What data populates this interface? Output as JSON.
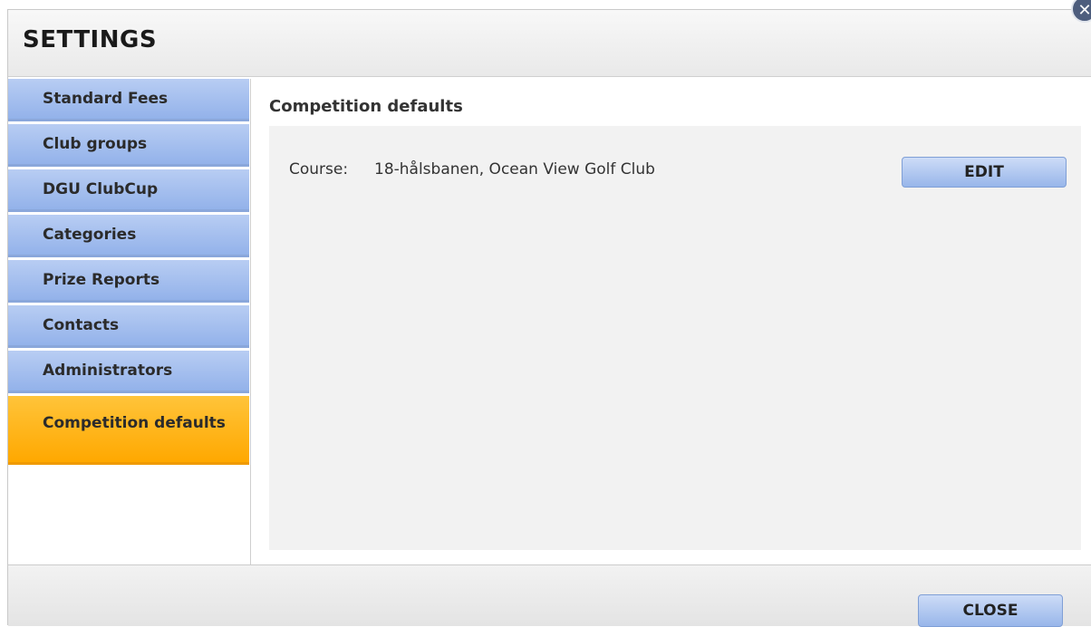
{
  "dialog": {
    "title": "SETTINGS",
    "close_icon_symbol": "✕"
  },
  "sidebar": {
    "items": [
      {
        "label": "Standard Fees",
        "active": false
      },
      {
        "label": "Club groups",
        "active": false
      },
      {
        "label": "DGU ClubCup",
        "active": false
      },
      {
        "label": "Categories",
        "active": false
      },
      {
        "label": "Prize Reports",
        "active": false
      },
      {
        "label": "Contacts",
        "active": false
      },
      {
        "label": "Administrators",
        "active": false
      },
      {
        "label": "Competition defaults",
        "active": true
      }
    ]
  },
  "main": {
    "section_title": "Competition defaults",
    "course_label": "Course:",
    "course_value": "18-hålsbanen, Ocean View Golf Club",
    "edit_label": "EDIT"
  },
  "footer": {
    "close_label": "CLOSE"
  },
  "colors": {
    "nav_blue": "#a8c1f0",
    "nav_active_orange": "#ffb11a",
    "panel_gray": "#f2f2f2"
  }
}
